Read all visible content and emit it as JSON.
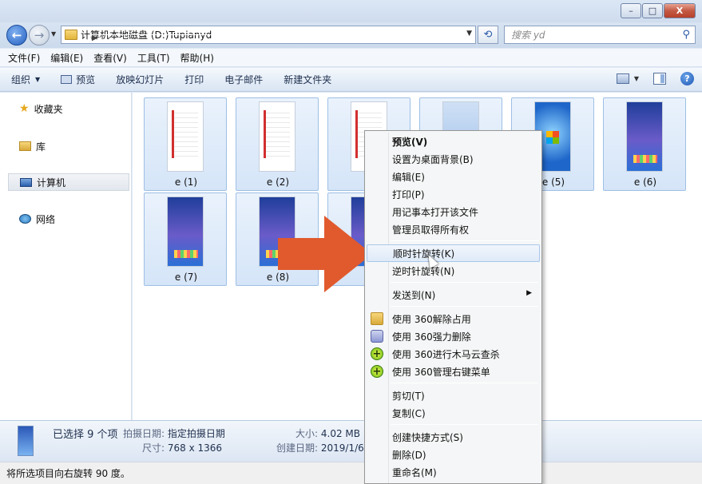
{
  "window": {
    "min_label": "–",
    "max_label": "□",
    "close_label": "X"
  },
  "address": {
    "crumbs": [
      "计算机",
      "本地磁盘 (D:)",
      "Tupian",
      "yd"
    ],
    "search_placeholder": "搜索 yd"
  },
  "menubar": [
    "文件(F)",
    "编辑(E)",
    "查看(V)",
    "工具(T)",
    "帮助(H)"
  ],
  "toolbar": {
    "organize": "组织",
    "preview": "预览",
    "slideshow": "放映幻灯片",
    "print": "打印",
    "email": "电子邮件",
    "new_folder": "新建文件夹"
  },
  "nav": {
    "favorites": "收藏夹",
    "libraries": "库",
    "computer": "计算机",
    "network": "网络"
  },
  "files": [
    {
      "label": "e (1)"
    },
    {
      "label": "e (2)"
    },
    {
      "label": "e"
    },
    {
      "label": ""
    },
    {
      "label": "e (5)"
    },
    {
      "label": "e (6)"
    },
    {
      "label": "e (7)"
    },
    {
      "label": "e (8)"
    },
    {
      "label": "e"
    }
  ],
  "details": {
    "selected": "已选择 9 个项",
    "shot_date_key": "拍摄日期:",
    "shot_date_val": "指定拍摄日期",
    "dim_key": "尺寸:",
    "dim_val": "768 x 1366",
    "size_key": "大小:",
    "size_val": "4.02 MB",
    "created_key": "创建日期:",
    "created_val": "2019/1/6"
  },
  "status": "将所选项目向右旋转 90 度。",
  "context_menu": {
    "preview": "预览(V)",
    "set_bg": "设置为桌面背景(B)",
    "edit": "编辑(E)",
    "print": "打印(P)",
    "notepad": "用记事本打开该文件",
    "admin": "管理员取得所有权",
    "rotate_cw": "顺时针旋转(K)",
    "rotate_ccw": "逆时针旋转(N)",
    "send_to": "发送到(N)",
    "unlock360": "使用 360解除占用",
    "shred360": "使用 360强力删除",
    "scan360": "使用 360进行木马云查杀",
    "menu360": "使用 360管理右键菜单",
    "cut": "剪切(T)",
    "copy": "复制(C)",
    "shortcut": "创建快捷方式(S)",
    "delete": "删除(D)",
    "rename": "重命名(M)"
  },
  "colors": {
    "arrow": "#e05a2e",
    "selection": "#d5e5f8"
  }
}
